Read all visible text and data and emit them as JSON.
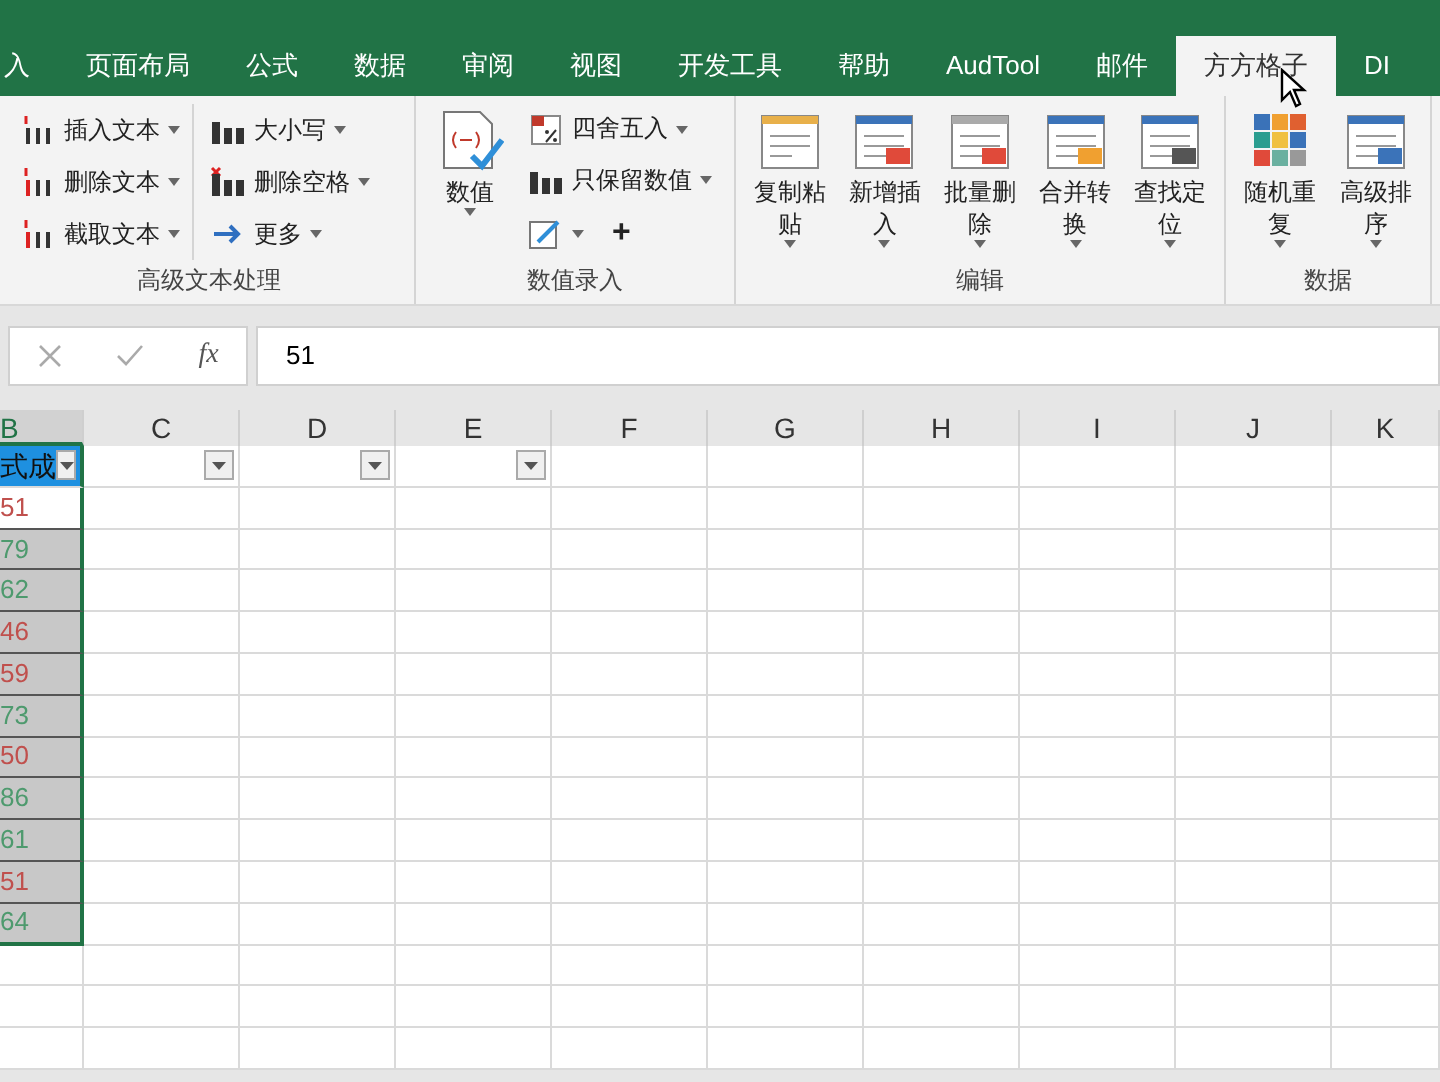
{
  "tabs": [
    {
      "label": "入",
      "selected": false
    },
    {
      "label": "页面布局",
      "selected": false
    },
    {
      "label": "公式",
      "selected": false
    },
    {
      "label": "数据",
      "selected": false
    },
    {
      "label": "审阅",
      "selected": false
    },
    {
      "label": "视图",
      "selected": false
    },
    {
      "label": "开发工具",
      "selected": false
    },
    {
      "label": "帮助",
      "selected": false
    },
    {
      "label": "AudTool",
      "selected": false
    },
    {
      "label": "邮件",
      "selected": false
    },
    {
      "label": "方方格子",
      "selected": true
    },
    {
      "label": "DI",
      "selected": false
    }
  ],
  "ribbon": {
    "groups": [
      {
        "label": "高级文本处理",
        "columns": [
          [
            {
              "label": "插入文本"
            },
            {
              "label": "删除文本"
            },
            {
              "label": "截取文本"
            }
          ],
          [
            {
              "label": "大小写"
            },
            {
              "label": "删除空格"
            },
            {
              "label": "更多"
            }
          ]
        ]
      },
      {
        "label": "数值录入",
        "big": [
          {
            "label": "数值"
          }
        ],
        "columns": [
          [
            {
              "label": "四舍五入"
            },
            {
              "label": "只保留数值"
            },
            {
              "label": "+"
            }
          ]
        ]
      },
      {
        "label": "编辑",
        "big": [
          {
            "label": "复制粘贴"
          },
          {
            "label": "新增插入"
          },
          {
            "label": "批量删除"
          },
          {
            "label": "合并转换"
          },
          {
            "label": "查找定位"
          }
        ]
      },
      {
        "label": "数据",
        "big": [
          {
            "label": "随机重复"
          },
          {
            "label": "高级排序"
          }
        ]
      }
    ]
  },
  "formula_bar": {
    "function_label": "fx",
    "value": "51"
  },
  "sheet": {
    "columns": [
      {
        "label": "B",
        "selected": true
      },
      {
        "label": "C",
        "selected": false
      },
      {
        "label": "D",
        "selected": false
      },
      {
        "label": "E",
        "selected": false
      },
      {
        "label": "F",
        "selected": false
      },
      {
        "label": "G",
        "selected": false
      },
      {
        "label": "H",
        "selected": false
      },
      {
        "label": "I",
        "selected": false
      },
      {
        "label": "J",
        "selected": false
      },
      {
        "label": "K",
        "selected": false
      }
    ],
    "header_row": [
      {
        "text": "式成",
        "filter": true
      },
      {
        "filter": true
      },
      {
        "filter": true
      },
      {
        "filter": true
      }
    ],
    "values": [
      {
        "text": "51",
        "color": "#c0504d",
        "active": true
      },
      {
        "text": "79",
        "color": "#4e9a6e",
        "active": false
      },
      {
        "text": "62",
        "color": "#4e9a6e",
        "active": false
      },
      {
        "text": "46",
        "color": "#c0504d",
        "active": false
      },
      {
        "text": "59",
        "color": "#c0504d",
        "active": false
      },
      {
        "text": "73",
        "color": "#4e9a6e",
        "active": false
      },
      {
        "text": "50",
        "color": "#c0504d",
        "active": false
      },
      {
        "text": "86",
        "color": "#4e9a6e",
        "active": false
      },
      {
        "text": "61",
        "color": "#4e9a6e",
        "active": false
      },
      {
        "text": "51",
        "color": "#c0504d",
        "active": false
      },
      {
        "text": "64",
        "color": "#4e9a6e",
        "active": false
      }
    ]
  }
}
